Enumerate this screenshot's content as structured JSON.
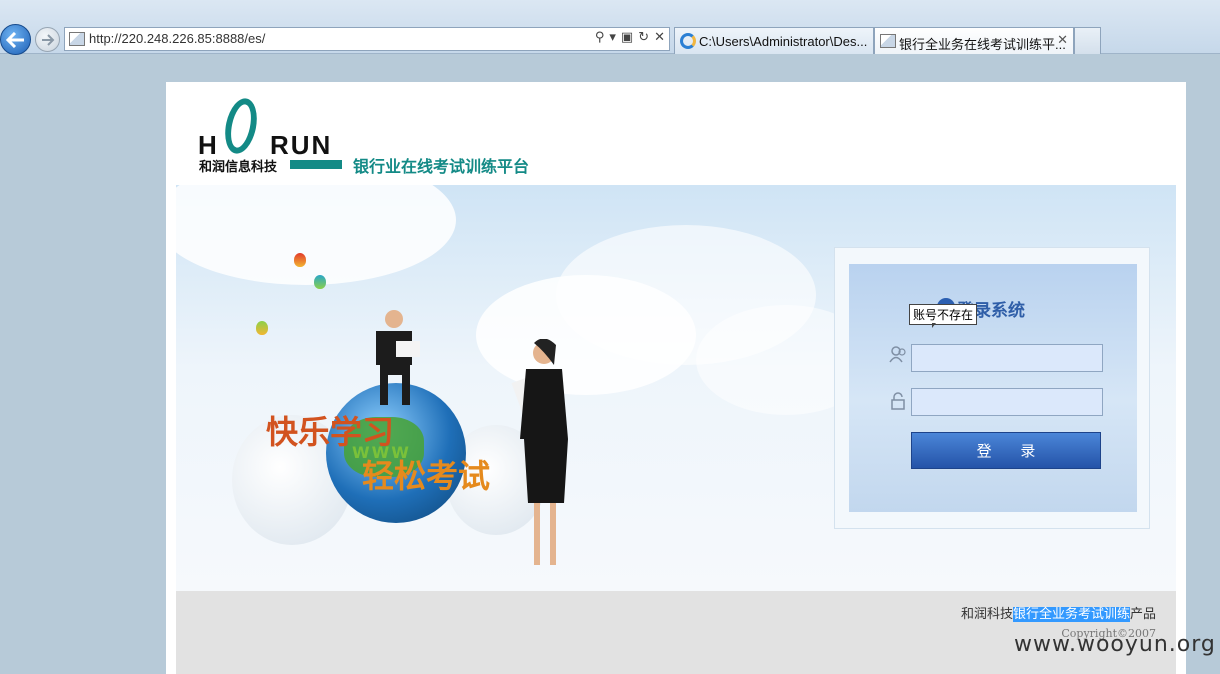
{
  "browser": {
    "url": "http://220.248.226.85:8888/es/",
    "tabs": [
      {
        "label": "C:\\Users\\Administrator\\Des..."
      },
      {
        "label": "银行全业务在线考试训练平..."
      }
    ]
  },
  "header": {
    "logo_text": "HORUN",
    "logo_cn": "和润信息科技",
    "platform_title": "银行业在线考试训练平台"
  },
  "banner": {
    "slogan1": "快乐学习",
    "slogan2": "轻松考试",
    "www": "WWW"
  },
  "login": {
    "title": "登录系统",
    "tooltip": "账号不存在",
    "username_value": "",
    "password_value": "",
    "submit_label": "登 录"
  },
  "footer": {
    "product_prefix": "和润科技",
    "product_highlight": "银行全业务考试训练",
    "product_suffix": "产品",
    "copyright": "Copyright©2007"
  },
  "watermark": "www.wooyun.org",
  "colors": {
    "brand": "#138a86",
    "login_button": "#2f5ea8",
    "highlight": "#3399ff"
  }
}
